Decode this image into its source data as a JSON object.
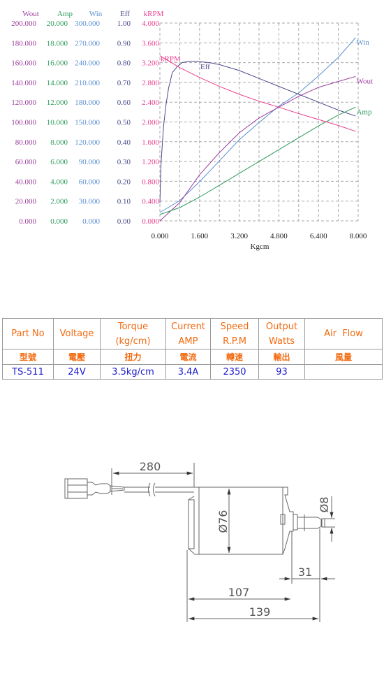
{
  "chart_data": {
    "type": "line",
    "title": "",
    "xlabel": "Kgcm",
    "xlim": [
      0,
      8
    ],
    "x_ticks": [
      "0.000",
      "1.600",
      "3.200",
      "4.800",
      "6.400",
      "8.000"
    ],
    "grid": true,
    "axes": [
      {
        "name": "Wout",
        "color": "#9b3f9b",
        "ylim": [
          0,
          200
        ],
        "ticks": [
          "0.000",
          "20.000",
          "40.000",
          "60.000",
          "80.000",
          "100.000",
          "120.000",
          "140.000",
          "160.000",
          "180.000",
          "200.000"
        ]
      },
      {
        "name": "Amp",
        "color": "#2e9a5c",
        "ylim": [
          0,
          20
        ],
        "ticks": [
          "0.000",
          "2.000",
          "4.000",
          "6.000",
          "8.000",
          "10.000",
          "12.000",
          "14.000",
          "16.000",
          "18.000",
          "20.000"
        ]
      },
      {
        "name": "Win",
        "color": "#5b8fd0",
        "ylim": [
          0,
          300
        ],
        "ticks": [
          "0.000",
          "30.000",
          "60.000",
          "90.000",
          "120.000",
          "150.000",
          "180.000",
          "210.000",
          "240.000",
          "270.000",
          "300.000"
        ]
      },
      {
        "name": "Eff",
        "color": "#4a4a8a",
        "ylim": [
          0,
          1
        ],
        "ticks": [
          "0.00",
          "0.10",
          "0.20",
          "0.30",
          "0.40",
          "0.50",
          "0.60",
          "0.70",
          "0.80",
          "0.90",
          "1.00"
        ]
      },
      {
        "name": "kRPM",
        "color": "#ec3f8f",
        "ylim": [
          0,
          4
        ],
        "ticks": [
          "0.000",
          "0.400",
          "0.800",
          "1.200",
          "1.600",
          "2.000",
          "2.400",
          "2.800",
          "3.200",
          "3.600",
          "4.000"
        ]
      }
    ],
    "series": [
      {
        "name": "Win",
        "axis": "Win",
        "label": "Win",
        "x": [
          0,
          0.8,
          1.6,
          2.4,
          3.2,
          4.0,
          4.8,
          5.6,
          6.4,
          7.2,
          7.9
        ],
        "y": [
          12.7,
          30.7,
          59.4,
          91,
          123,
          149,
          174,
          194,
          220,
          248,
          278
        ]
      },
      {
        "name": "Wout",
        "axis": "Wout",
        "label": "Wout",
        "x": [
          0,
          0.8,
          1.6,
          2.4,
          3.2,
          4.0,
          4.8,
          5.6,
          6.4,
          7.2,
          7.9
        ],
        "y": [
          0,
          18.4,
          46.6,
          69,
          89,
          104,
          115,
          126,
          135,
          141,
          146
        ]
      },
      {
        "name": "Amp",
        "axis": "Amp",
        "label": "Amp",
        "x": [
          0,
          0.8,
          1.6,
          2.4,
          3.2,
          4.0,
          4.8,
          5.6,
          6.4,
          7.2,
          7.9
        ],
        "y": [
          0.64,
          1.34,
          2.4,
          3.6,
          4.8,
          6.0,
          7.2,
          8.4,
          9.6,
          10.7,
          11.5
        ]
      },
      {
        "name": "Eff",
        "axis": "Eff",
        "label": "Eff",
        "x": [
          0,
          0.05,
          0.15,
          0.25,
          0.35,
          0.5,
          0.7,
          0.9,
          1.15,
          1.5,
          2.0,
          2.4,
          3.2,
          4.0,
          4.8,
          5.6,
          6.4,
          7.2,
          7.9
        ],
        "y": [
          0.09,
          0.3,
          0.48,
          0.59,
          0.67,
          0.75,
          0.78,
          0.8,
          0.806,
          0.806,
          0.8,
          0.79,
          0.76,
          0.72,
          0.68,
          0.64,
          0.6,
          0.56,
          0.53
        ]
      },
      {
        "name": "kRPM",
        "axis": "kRPM",
        "label": "kRPM",
        "x": [
          0,
          0.8,
          1.6,
          2.4,
          3.2,
          4.0,
          4.8,
          5.6,
          6.4,
          7.2,
          7.9
        ],
        "y": [
          3.34,
          3.1,
          2.9,
          2.72,
          2.56,
          2.42,
          2.3,
          2.17,
          2.05,
          1.93,
          1.81
        ]
      }
    ]
  },
  "spec_table": {
    "headers": [
      {
        "line1": "Part No",
        "line2": ""
      },
      {
        "line1": "Voltage",
        "line2": ""
      },
      {
        "line1": "Torque",
        "line2": "(kg/cm)"
      },
      {
        "line1": "Current",
        "line2": "AMP"
      },
      {
        "line1": "Speed",
        "line2": "R.P.M"
      },
      {
        "line1": "Output",
        "line2": "Watts"
      },
      {
        "line1": "Air  Flow",
        "line2": ""
      }
    ],
    "chinese_headers": [
      "型號",
      "電壓",
      "扭力",
      "電流",
      "轉速",
      "輸出",
      "風量"
    ],
    "values": [
      "TS-511",
      "24V",
      "3.5kg/cm",
      "3.4A",
      "2350",
      "93",
      ""
    ]
  },
  "drawing": {
    "cable_length": "280",
    "body_diameter": "Ø76",
    "shaft_diameter": "Ø8",
    "shaft_length": "31",
    "body_length": "107",
    "total_length": "139"
  }
}
